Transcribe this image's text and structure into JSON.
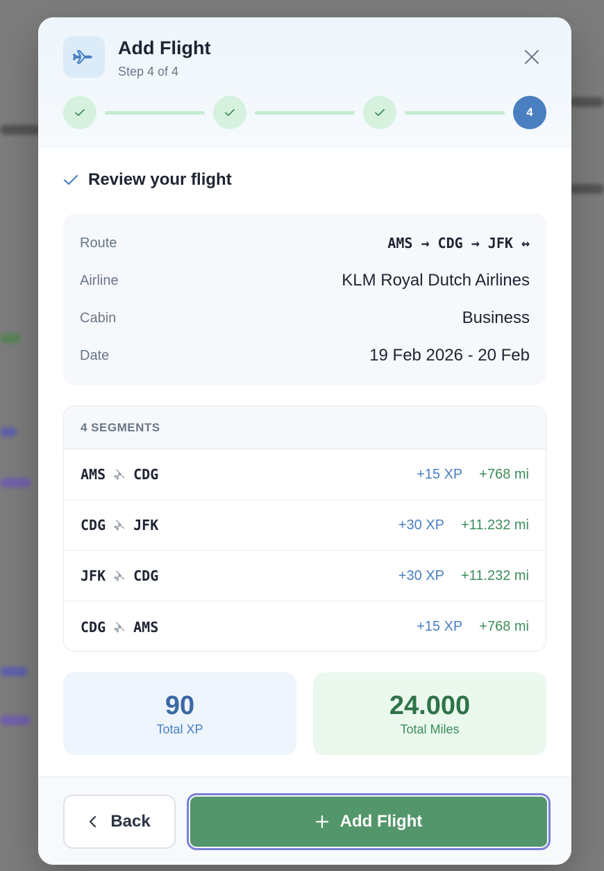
{
  "modal": {
    "title": "Add Flight",
    "step_text": "Step 4 of 4",
    "current_step": "4"
  },
  "review": {
    "title": "Review your flight",
    "rows": [
      {
        "label": "Route",
        "value": "AMS → CDG → JFK ↔"
      },
      {
        "label": "Airline",
        "value": "KLM Royal Dutch Airlines"
      },
      {
        "label": "Cabin",
        "value": "Business"
      },
      {
        "label": "Date",
        "value": "19 Feb 2026 - 20 Feb"
      }
    ]
  },
  "segments": {
    "header": "4 SEGMENTS",
    "items": [
      {
        "from": "AMS",
        "to": "CDG",
        "xp": "+15 XP",
        "miles": "+768 mi"
      },
      {
        "from": "CDG",
        "to": "JFK",
        "xp": "+30 XP",
        "miles": "+11.232 mi"
      },
      {
        "from": "JFK",
        "to": "CDG",
        "xp": "+30 XP",
        "miles": "+11.232 mi"
      },
      {
        "from": "CDG",
        "to": "AMS",
        "xp": "+15 XP",
        "miles": "+768 mi"
      }
    ]
  },
  "totals": {
    "xp_value": "90",
    "xp_label": "Total XP",
    "miles_value": "24.000",
    "miles_label": "Total Miles"
  },
  "footer": {
    "back_label": "Back",
    "add_label": "Add Flight"
  },
  "colors": {
    "accent_blue": "#4a7fc1",
    "accent_green": "#54966b",
    "step_done": "#d6f2df"
  },
  "icons": [
    "plane-icon",
    "close-icon",
    "check-icon",
    "plane-swap-icon",
    "chevron-left-icon",
    "plus-icon"
  ]
}
